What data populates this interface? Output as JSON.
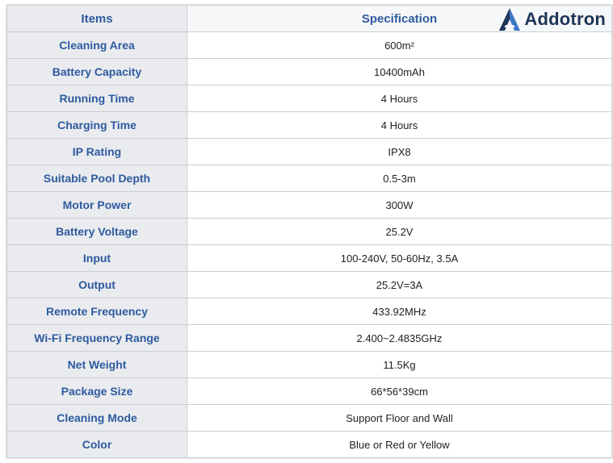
{
  "header": {
    "items_label": "Items",
    "spec_label": "Specification"
  },
  "logo": {
    "text": "Addotron",
    "icon": "addotron-logo-icon",
    "colors": {
      "dark": "#1d3557",
      "light": "#3b78c4"
    }
  },
  "rows": [
    {
      "label": "Cleaning Area",
      "value": "600m²"
    },
    {
      "label": "Battery Capacity",
      "value": "10400mAh"
    },
    {
      "label": "Running Time",
      "value": "4 Hours"
    },
    {
      "label": "Charging Time",
      "value": "4 Hours"
    },
    {
      "label": "IP Rating",
      "value": "IPX8"
    },
    {
      "label": "Suitable Pool Depth",
      "value": "0.5-3m"
    },
    {
      "label": "Motor Power",
      "value": "300W"
    },
    {
      "label": "Battery Voltage",
      "value": "25.2V"
    },
    {
      "label": "Input",
      "value": "100-240V, 50-60Hz, 3.5A"
    },
    {
      "label": "Output",
      "value": "25.2V=3A"
    },
    {
      "label": "Remote Frequency",
      "value": "433.92MHz"
    },
    {
      "label": "Wi-Fi Frequency Range",
      "value": "2.400~2.4835GHz"
    },
    {
      "label": "Net Weight",
      "value": "11.5Kg"
    },
    {
      "label": "Package Size",
      "value": "66*56*39cm"
    },
    {
      "label": "Cleaning Mode",
      "value": "Support Floor and Wall"
    },
    {
      "label": "Color",
      "value": "Blue or Red or Yellow"
    }
  ]
}
